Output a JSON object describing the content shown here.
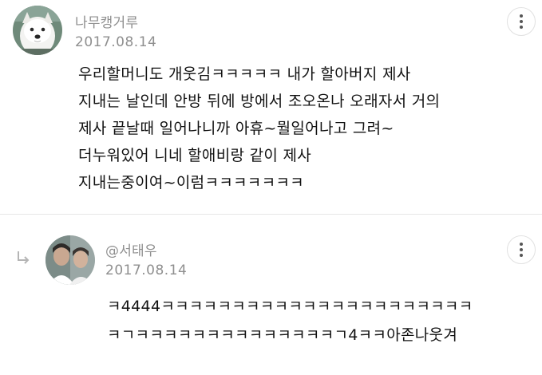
{
  "comments": [
    {
      "author": "나무캥거루",
      "date": "2017.08.14",
      "lines": [
        "우리할머니도 개웃김ㅋㅋㅋㅋㅋ 내가 할아버지 제사",
        "지내는 날인데 안방 뒤에 방에서 조오온나 오래자서 거의",
        "제사 끝날때 일어나니까 아휴~뭘일어나고 그려~",
        "더누워있어 니네 할애비랑 같이 제사",
        "지내는중이여~이럼ㅋㅋㅋㅋㅋㅋㅋ"
      ],
      "avatar_icon": "white-dog-avatar"
    },
    {
      "author": "@서태우",
      "date": "2017.08.14",
      "lines": [
        "ㅋ4444ㅋㅋㅋㅋㅋㅋㅋㅋㅋㅋㅋㅋㅋㅋㅋㅋㅋㅋㅋㅋㅋㅋ",
        "ㅋㄱㅋㅋㅋㅋㅋㅋㅋㅋㅋㅋㅋㅋㅋㅋㄱ4ㅋㅋ아존나웃겨"
      ],
      "avatar_icon": "person-avatar",
      "reply_icon": "reply-arrow-icon"
    }
  ],
  "more_icon": "more-vertical-icon",
  "colors": {
    "meta_text": "#8f8f8f",
    "body_text": "#111111",
    "divider": "#e7e7e7"
  }
}
